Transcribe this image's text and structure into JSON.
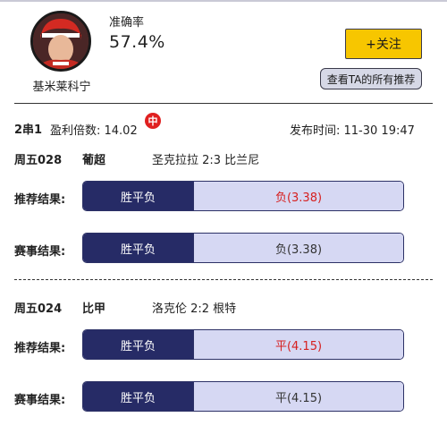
{
  "profile": {
    "username": "基米莱科宁",
    "accuracy_label": "准确率",
    "accuracy_value": "57.4%",
    "follow_label": "+关注",
    "view_all_label": "查看TA的所有推荐"
  },
  "summary": {
    "parlay": "2串1",
    "odds_label": "盈利倍数: 14.02",
    "hit_badge": "中",
    "publish_time": "发布时间:  11-30 19:47"
  },
  "matches": [
    {
      "match_no": "周五028",
      "league": "葡超",
      "teams": "圣克拉拉 2:3 比兰尼",
      "recommend_label": "推荐结果:",
      "recommend_type": "胜平负",
      "recommend_value": "负(3.38)",
      "result_label": "赛事结果:",
      "result_type": "胜平负",
      "result_value": "负(3.38)"
    },
    {
      "match_no": "周五024",
      "league": "比甲",
      "teams": "洛克伦 2:2 根特",
      "recommend_label": "推荐结果:",
      "recommend_type": "胜平负",
      "recommend_value": "平(4.15)",
      "result_label": "赛事结果:",
      "result_type": "胜平负",
      "result_value": "平(4.15)"
    }
  ],
  "colors": {
    "accent_yellow": "#f7c600",
    "bar_dark": "#262b66",
    "bar_light": "#d6d8f3",
    "hit_red": "#d62020"
  }
}
